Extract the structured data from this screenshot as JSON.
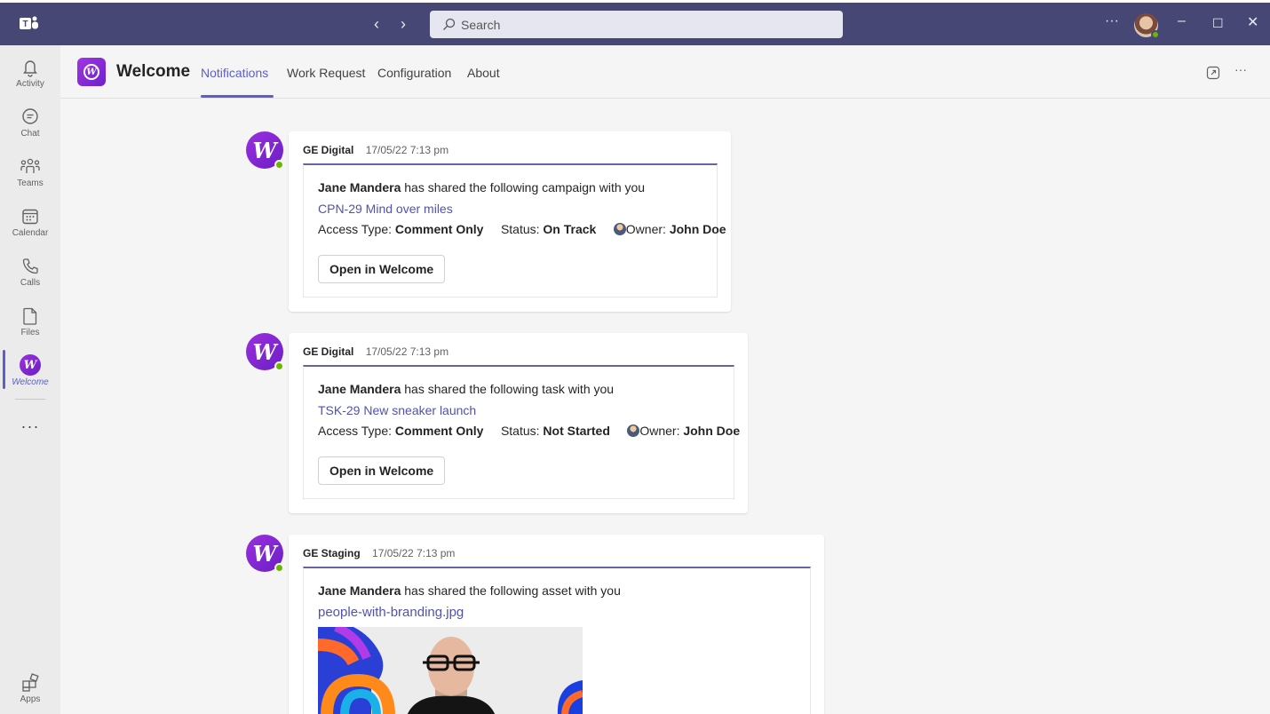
{
  "titlebar": {
    "search_placeholder": "Search",
    "more": "···",
    "minimize": "–",
    "maximize": "☐",
    "close": "✕"
  },
  "rail": {
    "items": [
      {
        "label": "Activity",
        "icon": "bell-icon"
      },
      {
        "label": "Chat",
        "icon": "chat-icon"
      },
      {
        "label": "Teams",
        "icon": "teams-icon"
      },
      {
        "label": "Calendar",
        "icon": "calendar-icon"
      },
      {
        "label": "Calls",
        "icon": "phone-icon"
      },
      {
        "label": "Files",
        "icon": "file-icon"
      },
      {
        "label": "Welcome",
        "icon": "welcome-app-icon"
      }
    ],
    "more": "···",
    "apps_label": "Apps",
    "active_color": "#5b5fc7"
  },
  "app": {
    "title": "Welcome",
    "tabs": [
      "Notifications",
      "Work Request",
      "Configuration",
      "About"
    ],
    "active_tab": "Notifications",
    "header_more": "···"
  },
  "messages": [
    {
      "sender": "GE Digital",
      "time": "17/05/22 7:13 pm",
      "actor": "Jane Mandera",
      "text": "has shared the following campaign with you",
      "link": "CPN-29 Mind over miles",
      "access_label": "Access Type:",
      "access_value": "Comment Only",
      "status_label": "Status:",
      "status_value": "On Track",
      "owner_label": "Owner:",
      "owner_value": "John Doe",
      "button": "Open in Welcome"
    },
    {
      "sender": "GE Digital",
      "time": "17/05/22 7:13 pm",
      "actor": "Jane Mandera",
      "text": "has shared the following task with you",
      "link": "TSK-29 New sneaker launch",
      "access_label": "Access Type:",
      "access_value": "Comment Only",
      "status_label": "Status:",
      "status_value": "Not Started",
      "owner_label": "Owner:",
      "owner_value": "John Doe",
      "button": "Open in Welcome"
    },
    {
      "sender": "GE Staging",
      "time": "17/05/22 7:13 pm",
      "actor": "Jane Mandera",
      "text": "has shared the following asset with you",
      "link": "people-with-branding.jpg"
    }
  ],
  "colors": {
    "titlebar": "#464775",
    "accent": "#5b5fc7",
    "link": "#4f52b2",
    "presence": "#6bb700"
  }
}
